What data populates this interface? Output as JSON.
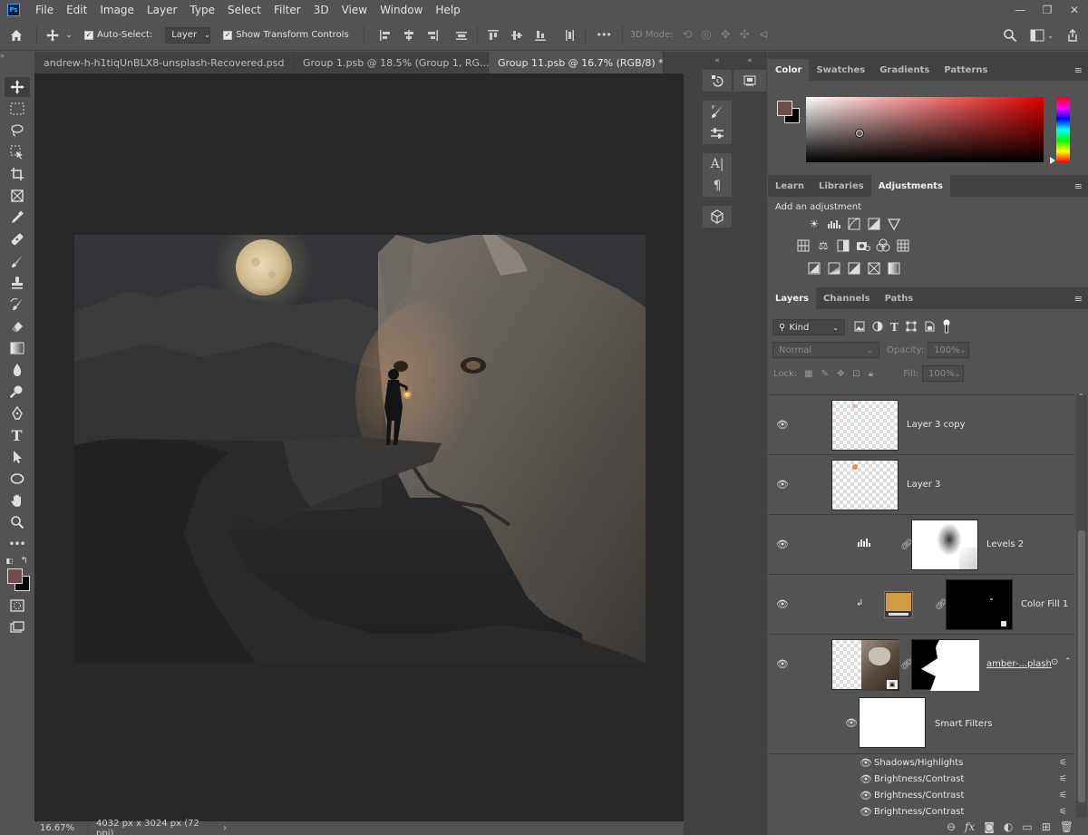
{
  "app": {
    "logo": "Ps"
  },
  "menu": [
    "File",
    "Edit",
    "Image",
    "Layer",
    "Type",
    "Select",
    "Filter",
    "3D",
    "View",
    "Window",
    "Help"
  ],
  "window_controls": {
    "minimize": "—",
    "restore": "❐",
    "close": "✕"
  },
  "options": {
    "auto_select_label": "Auto-Select:",
    "auto_select_value": "Layer",
    "transform_label": "Show Transform Controls",
    "more": "•••",
    "mode_3d": "3D Mode:"
  },
  "tabs": [
    {
      "label": "andrew-h-h1tiqUnBLX8-unsplash-Recovered.psd",
      "close": "×"
    },
    {
      "label": "Group 1.psb @ 18.5% (Group 1, RG...",
      "close": "×"
    },
    {
      "label": "Group 11.psb @ 16.7% (RGB/8) *",
      "close": "×"
    }
  ],
  "status": {
    "zoom": "16.67%",
    "doc_info": "4032 px x 3024 px (72 ppi)",
    "arrow": "›"
  },
  "color_panel": {
    "tabs": [
      "Color",
      "Swatches",
      "Gradients",
      "Patterns"
    ],
    "fg": "#6e4d4b",
    "bg": "#000000"
  },
  "adjustments_panel": {
    "tabs": [
      "Learn",
      "Libraries",
      "Adjustments"
    ],
    "title": "Add an adjustment"
  },
  "layers_panel": {
    "tabs": [
      "Layers",
      "Channels",
      "Paths"
    ],
    "kind": "Kind",
    "blend_mode": "Normal",
    "opacity_label": "Opacity:",
    "opacity_value": "100%",
    "lock_label": "Lock:",
    "fill_label": "Fill:",
    "fill_value": "100%",
    "layers": [
      {
        "name": "Layer 3 copy"
      },
      {
        "name": "Layer 3"
      },
      {
        "name": "Levels 2"
      },
      {
        "name": "Color Fill 1",
        "fill_color": "#d39a44"
      },
      {
        "name": "amber-...plash"
      },
      {
        "name": "Smart Filters"
      }
    ],
    "filters": [
      "Shadows/Highlights",
      "Brightness/Contrast",
      "Brightness/Contrast",
      "Brightness/Contrast"
    ]
  }
}
